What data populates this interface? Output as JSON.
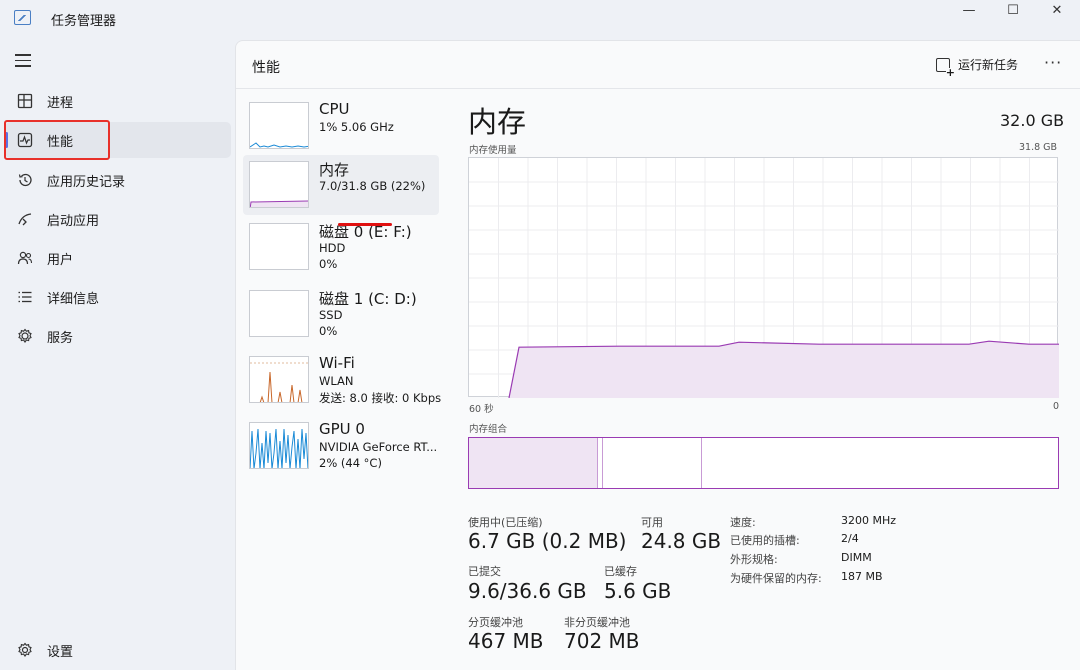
{
  "window": {
    "title": "任务管理器",
    "controls": {
      "minimize": "—",
      "maximize": "☐",
      "close": "✕"
    }
  },
  "sidebar": {
    "items": [
      {
        "label": "进程",
        "icon": "processes-icon"
      },
      {
        "label": "性能",
        "icon": "performance-icon"
      },
      {
        "label": "应用历史记录",
        "icon": "app-history-icon"
      },
      {
        "label": "启动应用",
        "icon": "startup-apps-icon"
      },
      {
        "label": "用户",
        "icon": "users-icon"
      },
      {
        "label": "详细信息",
        "icon": "details-icon"
      },
      {
        "label": "服务",
        "icon": "services-icon"
      }
    ],
    "settings_label": "设置"
  },
  "header": {
    "title": "性能",
    "run_new_task": "运行新任务",
    "more": "···"
  },
  "devices": [
    {
      "name": "CPU",
      "line1": "1% 5.06 GHz",
      "line2": ""
    },
    {
      "name": "内存",
      "line1": "7.0/31.8 GB (22%)",
      "line2": ""
    },
    {
      "name": "磁盘 0 (E: F:)",
      "line1": "HDD",
      "line2": "0%"
    },
    {
      "name": "磁盘 1 (C: D:)",
      "line1": "SSD",
      "line2": "0%"
    },
    {
      "name": "Wi-Fi",
      "line1": "WLAN",
      "line2": "发送: 8.0  接收: 0 Kbps"
    },
    {
      "name": "GPU 0",
      "line1": "NVIDIA GeForce RT...",
      "line2": "2% (44 °C)"
    }
  ],
  "detail": {
    "title": "内存",
    "total": "32.0 GB",
    "usage_label": "内存使用量",
    "usage_max": "31.8 GB",
    "x_left": "60 秒",
    "x_right": "0",
    "composition_label": "内存组合",
    "usage_fraction": 0.22,
    "composition": {
      "in_use_fraction": 0.22,
      "modified_fraction": 0.008,
      "standby_fraction": 0.168
    },
    "stats": [
      {
        "label": "使用中(已压缩)",
        "value": "6.7 GB (0.2 MB)"
      },
      {
        "label": "可用",
        "value": "24.8 GB"
      },
      {
        "label": "已提交",
        "value": "9.6/36.6 GB"
      },
      {
        "label": "已缓存",
        "value": "5.6 GB"
      },
      {
        "label": "分页缓冲池",
        "value": "467 MB"
      },
      {
        "label": "非分页缓冲池",
        "value": "702 MB"
      }
    ],
    "specs": [
      {
        "key": "速度:",
        "value": "3200 MHz"
      },
      {
        "key": "已使用的插槽:",
        "value": "2/4"
      },
      {
        "key": "外形规格:",
        "value": "DIMM"
      },
      {
        "key": "为硬件保留的内存:",
        "value": "187 MB"
      }
    ]
  },
  "colors": {
    "memory_accent": "#9a3bb3",
    "memory_fill": "#efe4f3",
    "cpu_accent": "#1a8ad6",
    "wifi_accent": "#c8672a",
    "gpu_accent": "#1a8ad6",
    "annotation_red": "#e8302a"
  }
}
